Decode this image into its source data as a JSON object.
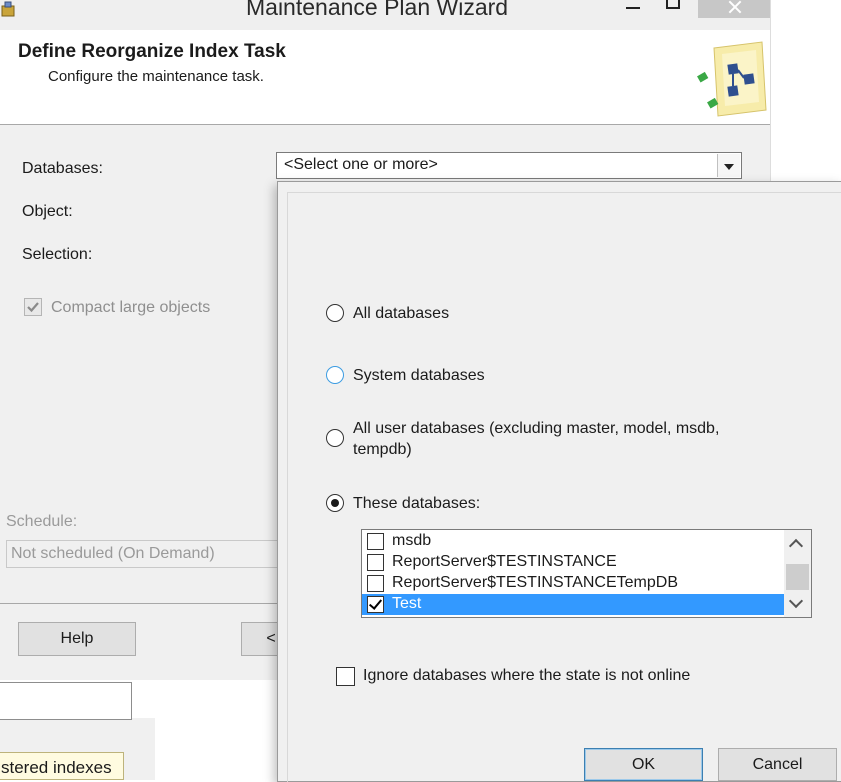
{
  "window": {
    "title": "Maintenance Plan Wizard"
  },
  "header": {
    "title": "Define Reorganize Index Task",
    "subtitle": "Configure the maintenance task."
  },
  "form": {
    "databases_label": "Databases:",
    "databases_value": "<Select one or more>",
    "object_label": "Object:",
    "selection_label": "Selection:",
    "compact_label": "Compact large objects",
    "compact_checked": true,
    "schedule_label": "Schedule:",
    "schedule_value": "Not scheduled (On Demand)"
  },
  "footer": {
    "help_label": "Help",
    "back_label": "<"
  },
  "background": {
    "clustered_text": "stered indexes"
  },
  "popup": {
    "options": [
      {
        "label": "All databases",
        "checked": false
      },
      {
        "label": "System databases",
        "checked": false
      },
      {
        "label_line1": "All user databases  (excluding master, model, msdb,",
        "label_line2": "tempdb)",
        "checked": false
      },
      {
        "label": "These databases:",
        "checked": true
      }
    ],
    "databases": [
      {
        "name": "msdb",
        "checked": false,
        "selected": false
      },
      {
        "name": "ReportServer$TESTINSTANCE",
        "checked": false,
        "selected": false
      },
      {
        "name": "ReportServer$TESTINSTANCETempDB",
        "checked": false,
        "selected": false
      },
      {
        "name": "Test",
        "checked": true,
        "selected": true
      }
    ],
    "ignore_label": "Ignore databases where the state is not online",
    "ignore_checked": false,
    "ok_label": "OK",
    "cancel_label": "Cancel"
  }
}
